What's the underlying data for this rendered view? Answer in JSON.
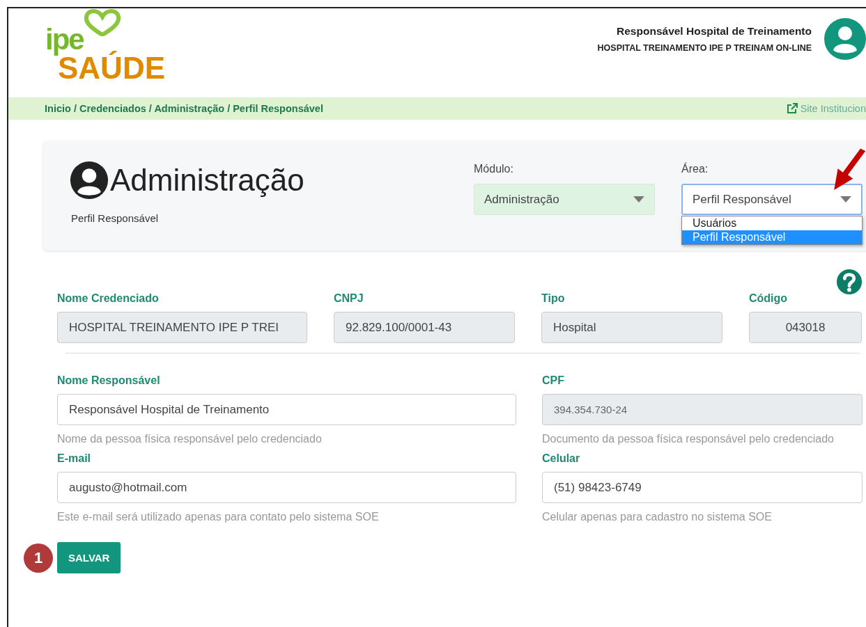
{
  "header": {
    "logo": {
      "top": "ipe",
      "bottom": "SAÚDE"
    },
    "user_name": "Responsável Hospital de Treinamento",
    "organization": "HOSPITAL TREINAMENTO IPE P TREINAM ON-LINE"
  },
  "breadcrumb": "Inicio / Credenciados / Administração / Perfil Responsável",
  "external_link": "Site Institucion",
  "module_header": {
    "title": "Administração",
    "subtitle": "Perfil Responsável",
    "selects": [
      {
        "label": "Módulo:",
        "value": "Administração",
        "open": false
      },
      {
        "label": "Área:",
        "value": "Perfil Responsável",
        "open": true,
        "options": [
          {
            "label": "Usuários",
            "selected": false
          },
          {
            "label": "Perfil Responsável",
            "selected": true
          }
        ]
      }
    ]
  },
  "info_fields": [
    {
      "label": "Nome Credenciado",
      "value": "HOSPITAL TREINAMENTO IPE P TREI",
      "centered": false
    },
    {
      "label": "CNPJ",
      "value": "92.829.100/0001-43",
      "centered": false
    },
    {
      "label": "Tipo",
      "value": "Hospital",
      "centered": false
    },
    {
      "label": "Código",
      "value": "043018",
      "centered": true
    }
  ],
  "fields": [
    {
      "label": "Nome Responsável",
      "value": "Responsável Hospital de Treinamento",
      "readonly": false,
      "help": "Nome da pessoa física responsável pelo credenciado"
    },
    {
      "label": "CPF",
      "value": "394.354.730-24",
      "readonly": true,
      "help": "Documento da pessoa física responsável pelo credenciado"
    },
    {
      "label": "E-mail",
      "value": "augusto@hotmail.com",
      "readonly": false,
      "help": "Este e-mail será utilizado apenas para contato pelo sistema SOE"
    },
    {
      "label": "Celular",
      "value": "(51) 98423-6749",
      "readonly": false,
      "help": "Celular apenas para cadastro no sistema SOE"
    }
  ],
  "save_button": "SALVAR",
  "step_badge": "1"
}
